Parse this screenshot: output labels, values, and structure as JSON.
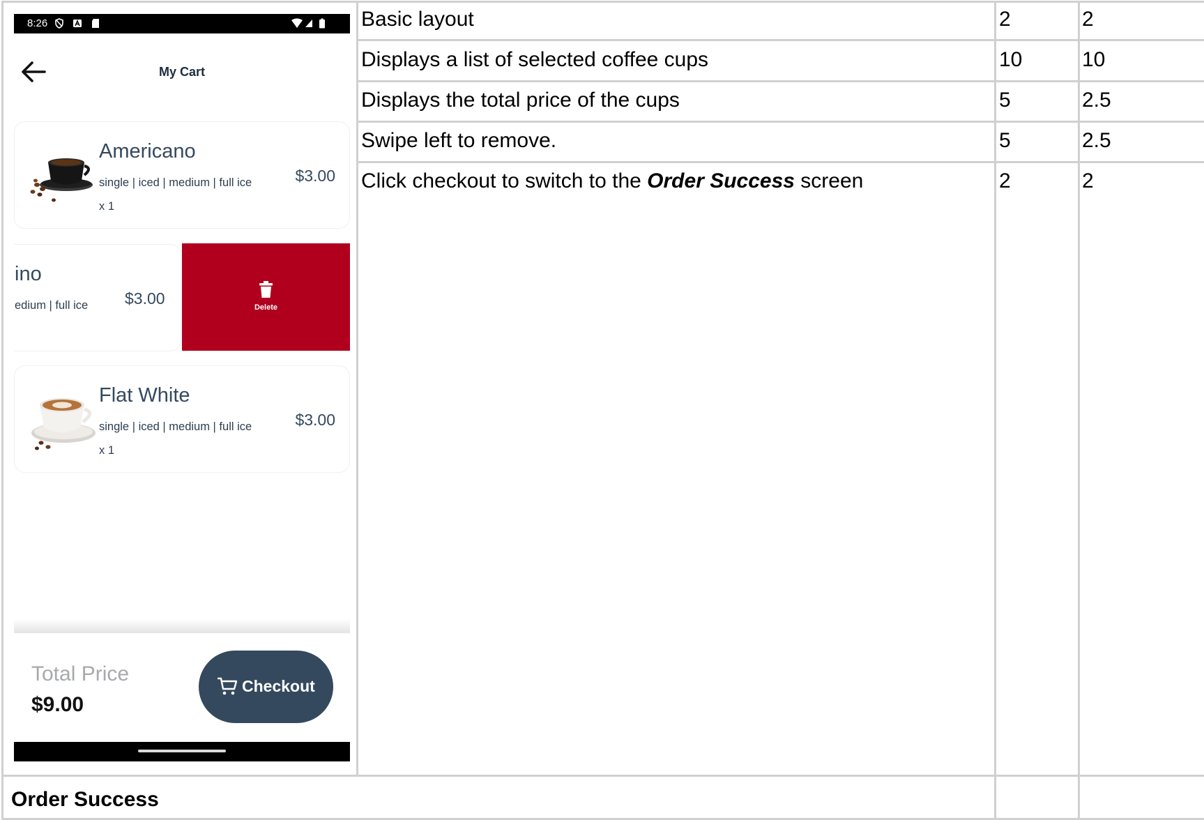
{
  "phone": {
    "status_bar": {
      "time": "8:26"
    },
    "app_bar": {
      "title": "My Cart"
    },
    "cart_items": [
      {
        "name": "Americano",
        "options": "single | iced | medium | full ice",
        "quantity": "x 1",
        "price": "$3.00"
      },
      {
        "name": "ino",
        "options": "edium | full ice",
        "price": "$3.00"
      },
      {
        "name": "Flat White",
        "options": "single | iced | medium | full ice",
        "quantity": "x 1",
        "price": "$3.00"
      }
    ],
    "delete_action": {
      "label": "Delete",
      "color": "#b0001e"
    },
    "total": {
      "label": "Total Price",
      "value": "$9.00"
    },
    "checkout": {
      "label": "Checkout",
      "color": "#34495e"
    }
  },
  "rubric": [
    {
      "criterion": "Basic layout",
      "max_points": "2",
      "awarded": "2"
    },
    {
      "criterion": "Displays a list of selected coffee cups",
      "max_points": "10",
      "awarded": "10"
    },
    {
      "criterion": "Displays the total price of the cups",
      "max_points": "5",
      "awarded": "2.5"
    },
    {
      "criterion": "Swipe left to remove.",
      "max_points": "5",
      "awarded": "2.5"
    },
    {
      "criterion_prefix": "Click checkout to switch to the ",
      "criterion_emphasis": "Order Success",
      "criterion_suffix": " screen",
      "max_points": "2",
      "awarded": "2"
    }
  ],
  "next_section": {
    "title": "Order Success"
  }
}
